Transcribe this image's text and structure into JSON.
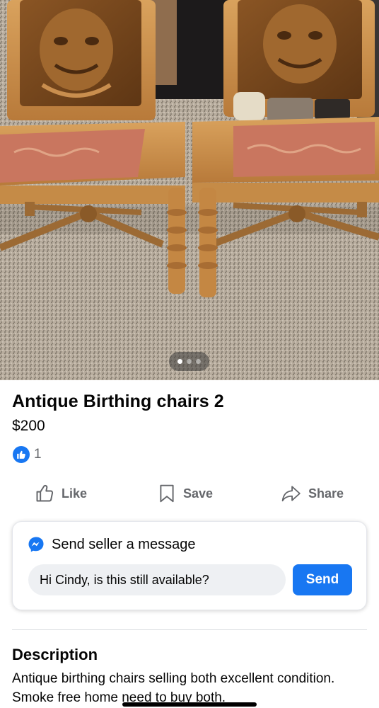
{
  "listing": {
    "title": "Antique Birthing chairs 2",
    "price": "$200",
    "reaction_count": "1",
    "photo_count": 3,
    "photo_index": 1
  },
  "actions": {
    "like_label": "Like",
    "save_label": "Save",
    "share_label": "Share"
  },
  "message": {
    "header": "Send seller a message",
    "input_value": "Hi Cindy, is this still available?",
    "send_label": "Send"
  },
  "description": {
    "heading": "Description",
    "body": "Antique birthing chairs selling both excellent condition. Smoke free home need to buy both."
  },
  "colors": {
    "accent": "#1877f2",
    "secondary_text": "#65676b",
    "input_bg": "#eef0f3"
  },
  "icons": [
    "like-thumb-icon",
    "bookmark-icon",
    "share-arrow-icon",
    "messenger-icon"
  ]
}
